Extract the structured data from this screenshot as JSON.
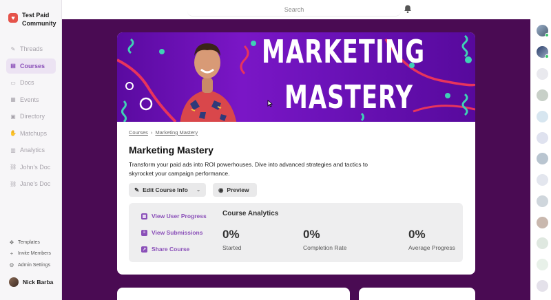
{
  "brand": {
    "name": "Test Paid Community",
    "logo_icon": "heart-icon"
  },
  "nav": [
    {
      "label": "Threads",
      "icon": "threads-icon",
      "active": false
    },
    {
      "label": "Courses",
      "icon": "book-icon",
      "active": true
    },
    {
      "label": "Docs",
      "icon": "doc-icon",
      "active": false
    },
    {
      "label": "Events",
      "icon": "calendar-icon",
      "active": false
    },
    {
      "label": "Directory",
      "icon": "directory-icon",
      "active": false
    },
    {
      "label": "Matchups",
      "icon": "matchups-icon",
      "active": false
    },
    {
      "label": "Analytics",
      "icon": "analytics-icon",
      "active": false
    },
    {
      "label": "John's Doc",
      "icon": "link-icon",
      "active": false
    },
    {
      "label": "Jane's Doc",
      "icon": "link-icon",
      "active": false
    }
  ],
  "bottom_links": [
    {
      "label": "Templates",
      "icon": "templates-icon"
    },
    {
      "label": "Invite Members",
      "icon": "plus-icon"
    },
    {
      "label": "Admin Settings",
      "icon": "gear-icon"
    }
  ],
  "user": {
    "name": "Nick Barba"
  },
  "topbar": {
    "search_label": "Search"
  },
  "banner": {
    "line1": "MARKETING",
    "line2": "MASTERY"
  },
  "breadcrumb": {
    "root": "Courses",
    "current": "Marketing Mastery"
  },
  "course": {
    "title": "Marketing Mastery",
    "description": "Transform your paid ads into ROI powerhouses. Dive into advanced strategies and tactics to skyrocket your campaign performance.",
    "edit_label": "Edit Course Info",
    "preview_label": "Preview"
  },
  "analytics": {
    "links": [
      "View User Progress",
      "View Submissions",
      "Share Course"
    ],
    "title": "Course Analytics",
    "stats": [
      {
        "value": "0%",
        "label": "Started"
      },
      {
        "value": "0%",
        "label": "Completion Rate"
      },
      {
        "value": "0%",
        "label": "Average Progress"
      }
    ]
  },
  "colors": {
    "accent": "#8a4fb8",
    "main_bg": "#4a0b53",
    "banner": "#7a16c6"
  }
}
